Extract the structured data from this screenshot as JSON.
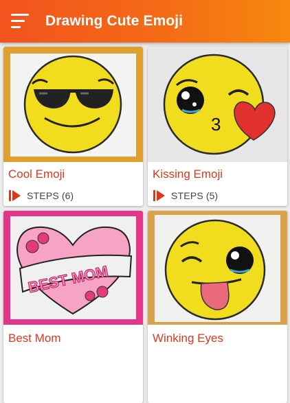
{
  "app": {
    "title": "Drawing Cute Emoji",
    "menu_icon": "hamburger-menu-icon",
    "colors": {
      "appbar_start": "#f2531d",
      "appbar_end": "#f6880f",
      "card_title": "#e0361c",
      "background": "#ececec"
    }
  },
  "cards": [
    {
      "title": "Cool Emoji",
      "steps_label": "STEPS",
      "steps_count": "(6)",
      "image": "sunglasses-emoji"
    },
    {
      "title": "Kissing Emoji",
      "steps_label": "STEPS",
      "steps_count": "(5)",
      "image": "kissing-emoji-with-heart"
    },
    {
      "title": "Best Mom",
      "image": "best-mom-heart"
    },
    {
      "title": "Winking Eyes",
      "image": "winking-tongue-emoji"
    }
  ],
  "steps_icon": "play-steps-icon"
}
